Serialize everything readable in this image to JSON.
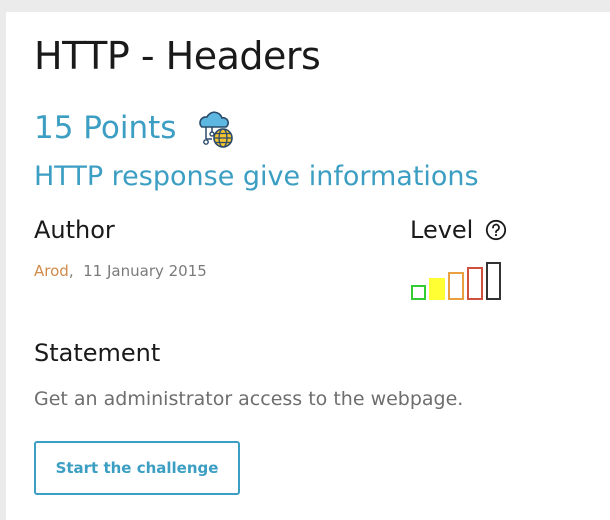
{
  "challenge": {
    "title": "HTTP - Headers",
    "points": "15 Points",
    "category_icon": "cloud-network-globe-icon",
    "subtitle": "HTTP response give informations"
  },
  "author": {
    "label": "Author",
    "name": "Arod",
    "separator": ",",
    "date": "11 January 2015"
  },
  "level": {
    "label": "Level",
    "help_icon": "question-circle-icon",
    "value": 1,
    "max": 5,
    "colors": [
      "#33cc33",
      "#ffff33",
      "#e8a040",
      "#d05040",
      "#333333"
    ]
  },
  "statement": {
    "label": "Statement",
    "text": "Get an administrator access to the webpage."
  },
  "actions": {
    "start_label": "Start the challenge"
  },
  "colors": {
    "accent": "#3b9ec2",
    "author": "#d08a4a"
  }
}
